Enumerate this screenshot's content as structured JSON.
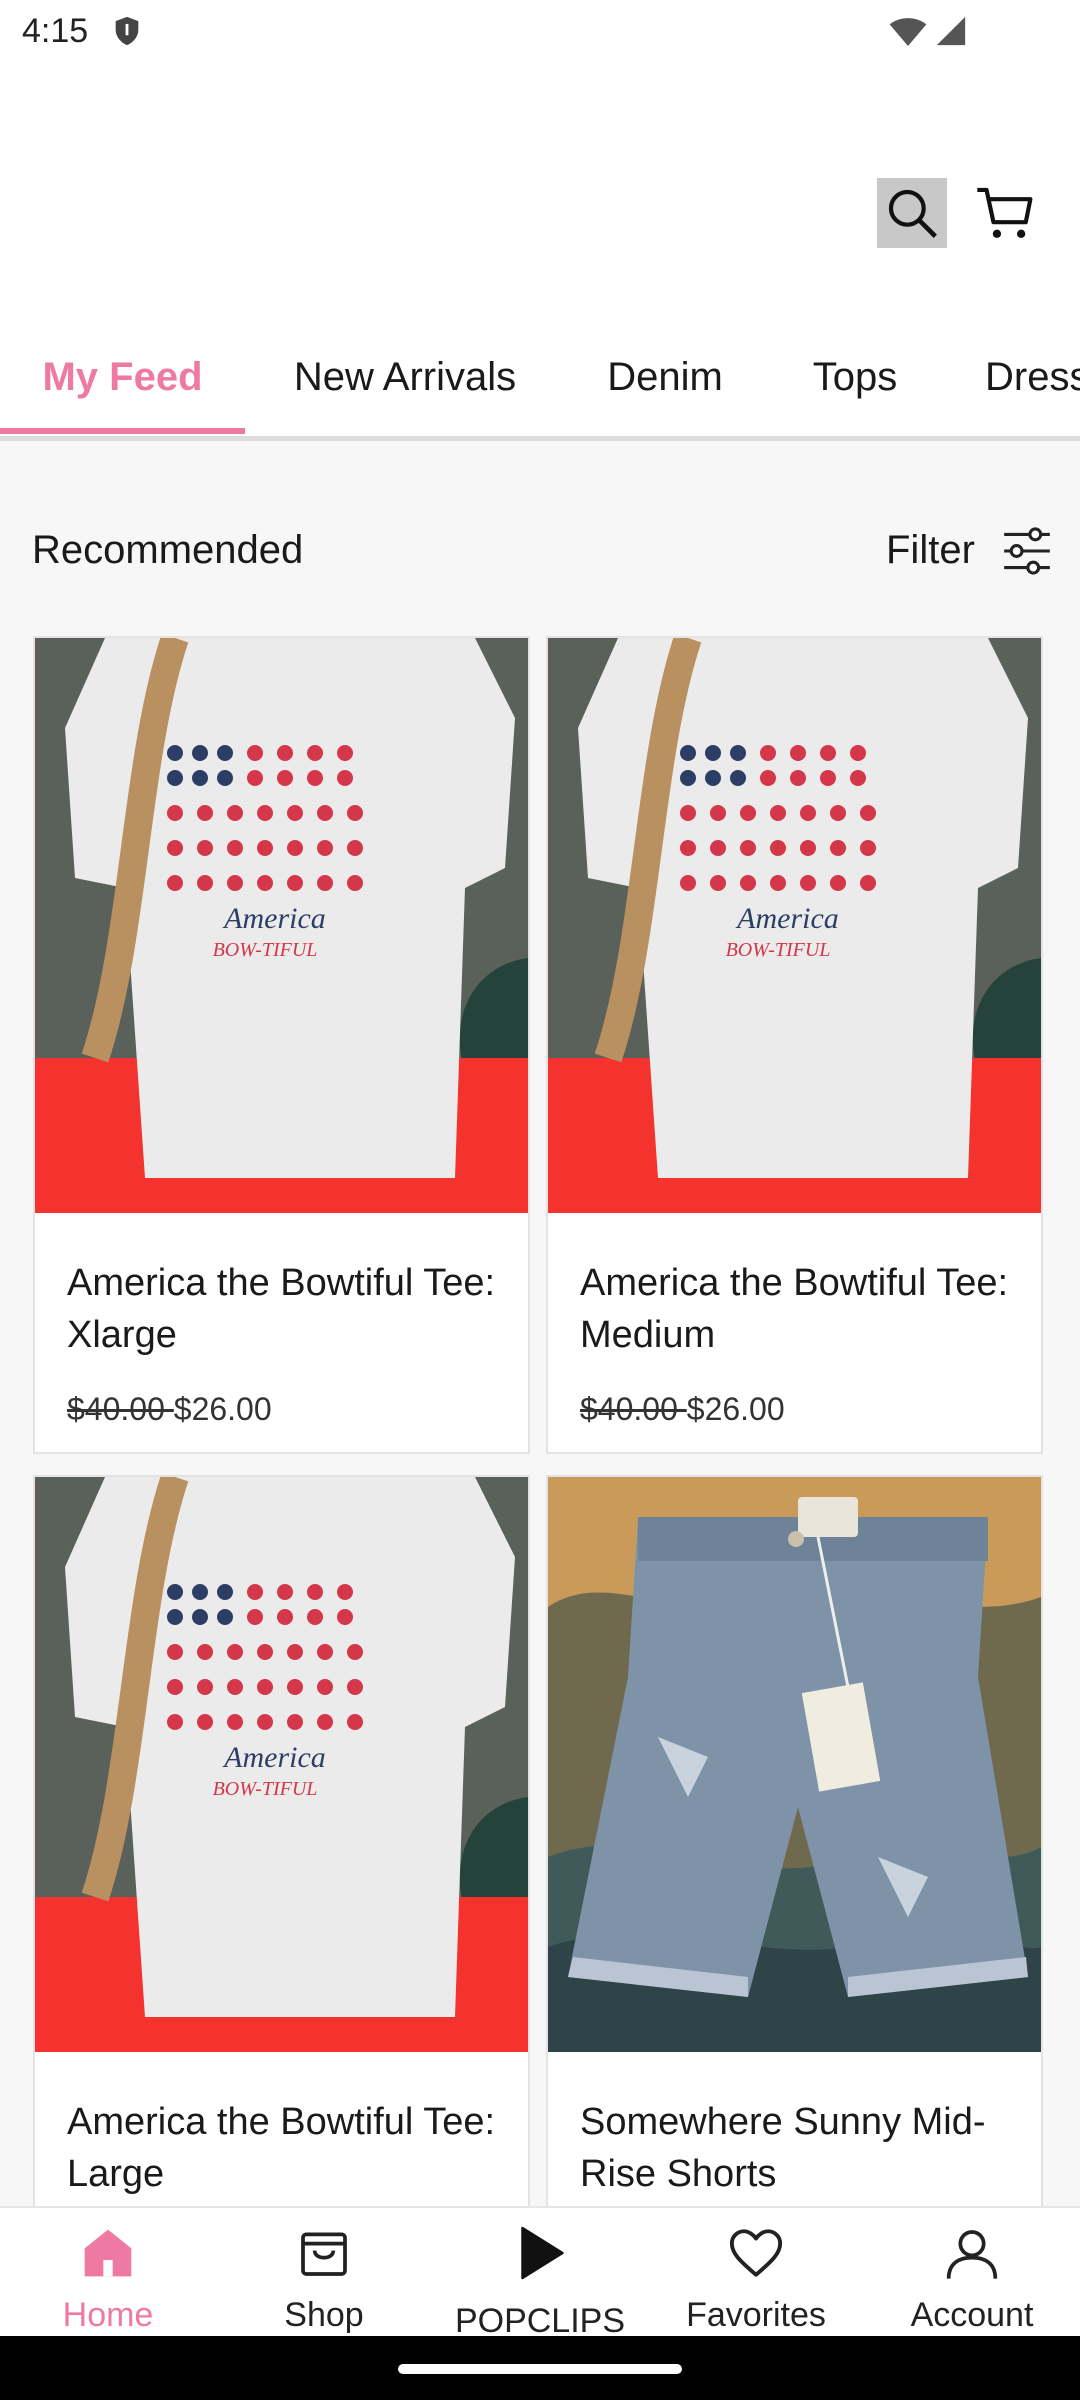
{
  "status_bar": {
    "time": "4:15"
  },
  "tabs": [
    "My Feed",
    "New Arrivals",
    "Denim",
    "Tops",
    "Dress"
  ],
  "section": {
    "title": "Recommended",
    "filter_label": "Filter"
  },
  "products": [
    {
      "name": "America the Bowtiful Tee: Xlarge",
      "old_price": "$40.00 ",
      "price": "$26.00"
    },
    {
      "name": "America the Bowtiful Tee: Medium",
      "old_price": "$40.00 ",
      "price": "$26.00"
    },
    {
      "name": "America the Bowtiful Tee: Large"
    },
    {
      "name": "Somewhere Sunny Mid-Rise Shorts"
    }
  ],
  "tee_print": {
    "line1": "America",
    "line2": "BOW-TIFUL"
  },
  "bottom_nav": [
    {
      "label": "Home",
      "icon": "home-icon"
    },
    {
      "label": "Shop",
      "icon": "shop-icon"
    },
    {
      "label": "POPCLIPS",
      "icon": "play-icon"
    },
    {
      "label": "Favorites",
      "icon": "heart-icon"
    },
    {
      "label": "Account",
      "icon": "account-icon"
    }
  ],
  "colors": {
    "accent": "#ee7aa3",
    "skirt": "#f4332f",
    "denim": "#7f93a8"
  }
}
